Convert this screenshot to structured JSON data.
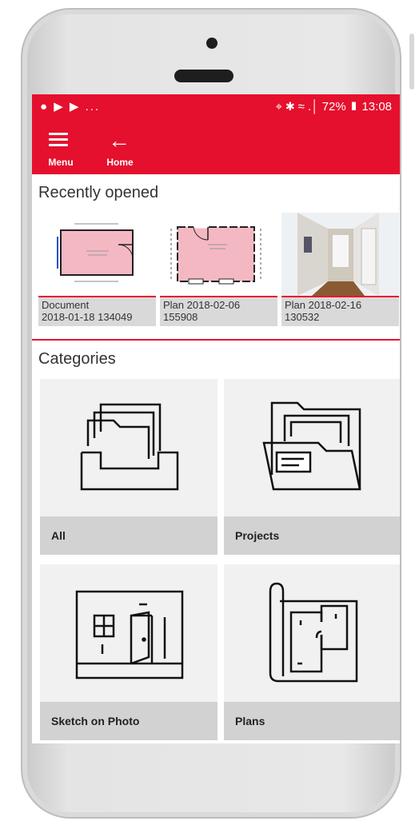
{
  "status_bar": {
    "left_icons": "● ▶ ▶ ...",
    "right_text": "⌖ ✱ ≈ .│ 72% ▮ 13:08"
  },
  "app_bar": {
    "menu_label": "Menu",
    "home_label": "Home",
    "color": "#e5102d"
  },
  "recent": {
    "title": "Recently opened",
    "items": [
      {
        "line1": "Document",
        "line2": "2018-01-18 134049",
        "thumb_icon": "floor-plan-thumbnail"
      },
      {
        "line1": "Plan 2018-02-06",
        "line2": "155908",
        "thumb_icon": "floor-plan-thumbnail"
      },
      {
        "line1": "Plan 2018-02-16",
        "line2": "130532",
        "thumb_icon": "hallway-photo-thumbnail"
      }
    ]
  },
  "categories": {
    "title": "Categories",
    "items": [
      {
        "label": "All",
        "icon": "file-tray-icon"
      },
      {
        "label": "Projects",
        "icon": "open-folder-icon"
      },
      {
        "label": "Sketch on Photo",
        "icon": "room-sketch-icon"
      },
      {
        "label": "Plans",
        "icon": "floor-plan-scroll-icon"
      }
    ]
  }
}
